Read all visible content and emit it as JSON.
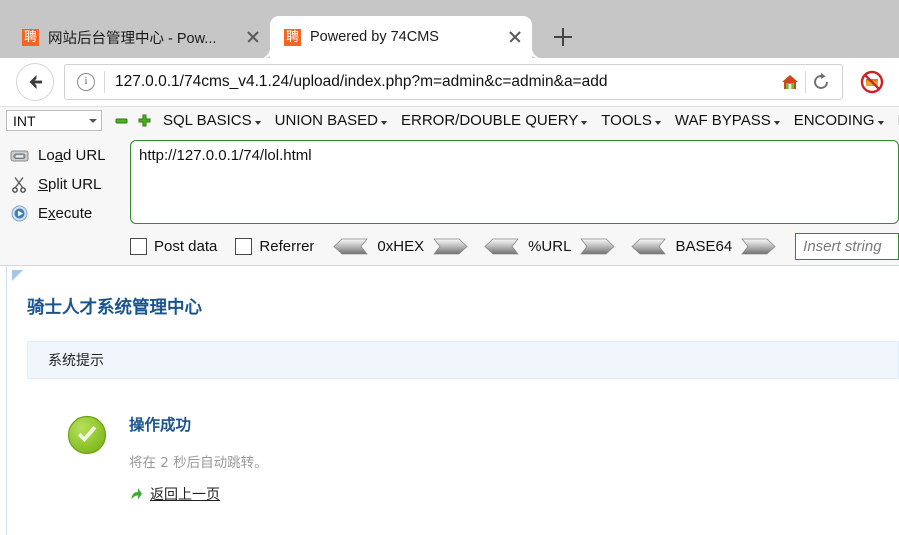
{
  "browser": {
    "tabs": [
      {
        "favicon_char": "聘",
        "title": "网站后台管理中心 - Pow...",
        "active": false
      },
      {
        "favicon_char": "聘",
        "title": "Powered by 74CMS",
        "active": true
      }
    ],
    "new_tab_label": "+",
    "nav": {
      "back_icon": "back-arrow-icon",
      "info_icon": "site-info-icon",
      "url": "127.0.0.1/74cms_v4.1.24/upload/index.php?m=admin&c=admin&a=add",
      "home_icon": "home-icon",
      "reload_icon": "reload-icon",
      "noscript_icon": "noscript-blocked-icon"
    }
  },
  "hackbar": {
    "type_select": {
      "value": "INT"
    },
    "remove_icon": "minus-icon",
    "add_icon": "plus-icon",
    "menus": [
      {
        "label": "SQL BASICS"
      },
      {
        "label": "UNION BASED"
      },
      {
        "label": "ERROR/DOUBLE QUERY"
      },
      {
        "label": "TOOLS"
      },
      {
        "label": "WAF BYPASS"
      },
      {
        "label": "ENCODING"
      },
      {
        "label": "HT"
      }
    ],
    "actions": [
      {
        "label_pre": "Lo",
        "label_u": "a",
        "label_post": "d URL",
        "icon": "load-url-icon"
      },
      {
        "label_pre": "",
        "label_u": "S",
        "label_post": "plit URL",
        "icon": "split-url-icon"
      },
      {
        "label_pre": "E",
        "label_u": "x",
        "label_post": "ecute",
        "icon": "execute-icon"
      }
    ],
    "url_textarea": "http://127.0.0.1/74/lol.html",
    "checkboxes": [
      {
        "label": "Post data",
        "checked": false
      },
      {
        "label": "Referrer",
        "checked": false
      }
    ],
    "encoders": [
      {
        "label": "0xHEX"
      },
      {
        "label": "%URL"
      },
      {
        "label": "BASE64"
      }
    ],
    "insert_string_placeholder": "Insert string"
  },
  "page": {
    "title": "骑士人才系统管理中心",
    "panel_header": "系统提示",
    "result": {
      "status_icon": "success-check-icon",
      "title": "操作成功",
      "subtitle": "将在 2 秒后自动跳转。",
      "back_icon": "back-green-arrow-icon",
      "link_label": "返回上一页"
    }
  },
  "colors": {
    "tab_strip": "#c6c6c6",
    "favicon_orange": "#f26522",
    "green_border": "#2e8b2e",
    "title_blue": "#1a5490",
    "panel_blue": "#f0f6fc",
    "success_green": "#8cc63f"
  }
}
